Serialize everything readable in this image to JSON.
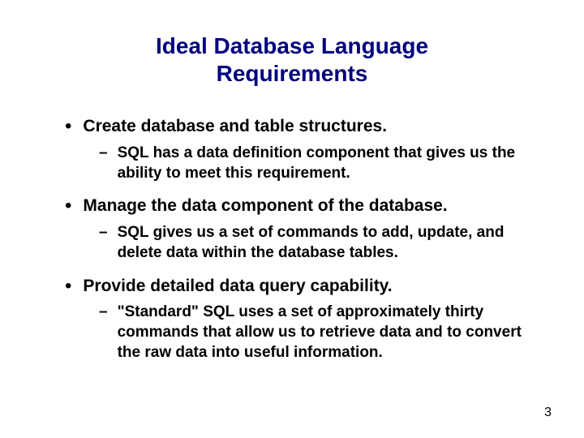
{
  "title_line1": "Ideal Database Language",
  "title_line2": "Requirements",
  "bullets": {
    "b1": "Create database and table structures.",
    "b1_sub": "SQL has a data definition component that gives us the ability to meet this requirement.",
    "b2": "Manage the data component of the database.",
    "b2_sub": "SQL gives us a set of commands to add, update, and delete data within the database tables.",
    "b3": "Provide detailed data query capability.",
    "b3_sub": "\"Standard\" SQL uses a set of approximately thirty commands that allow us to retrieve data and to convert the raw data into useful information."
  },
  "page_number": "3"
}
